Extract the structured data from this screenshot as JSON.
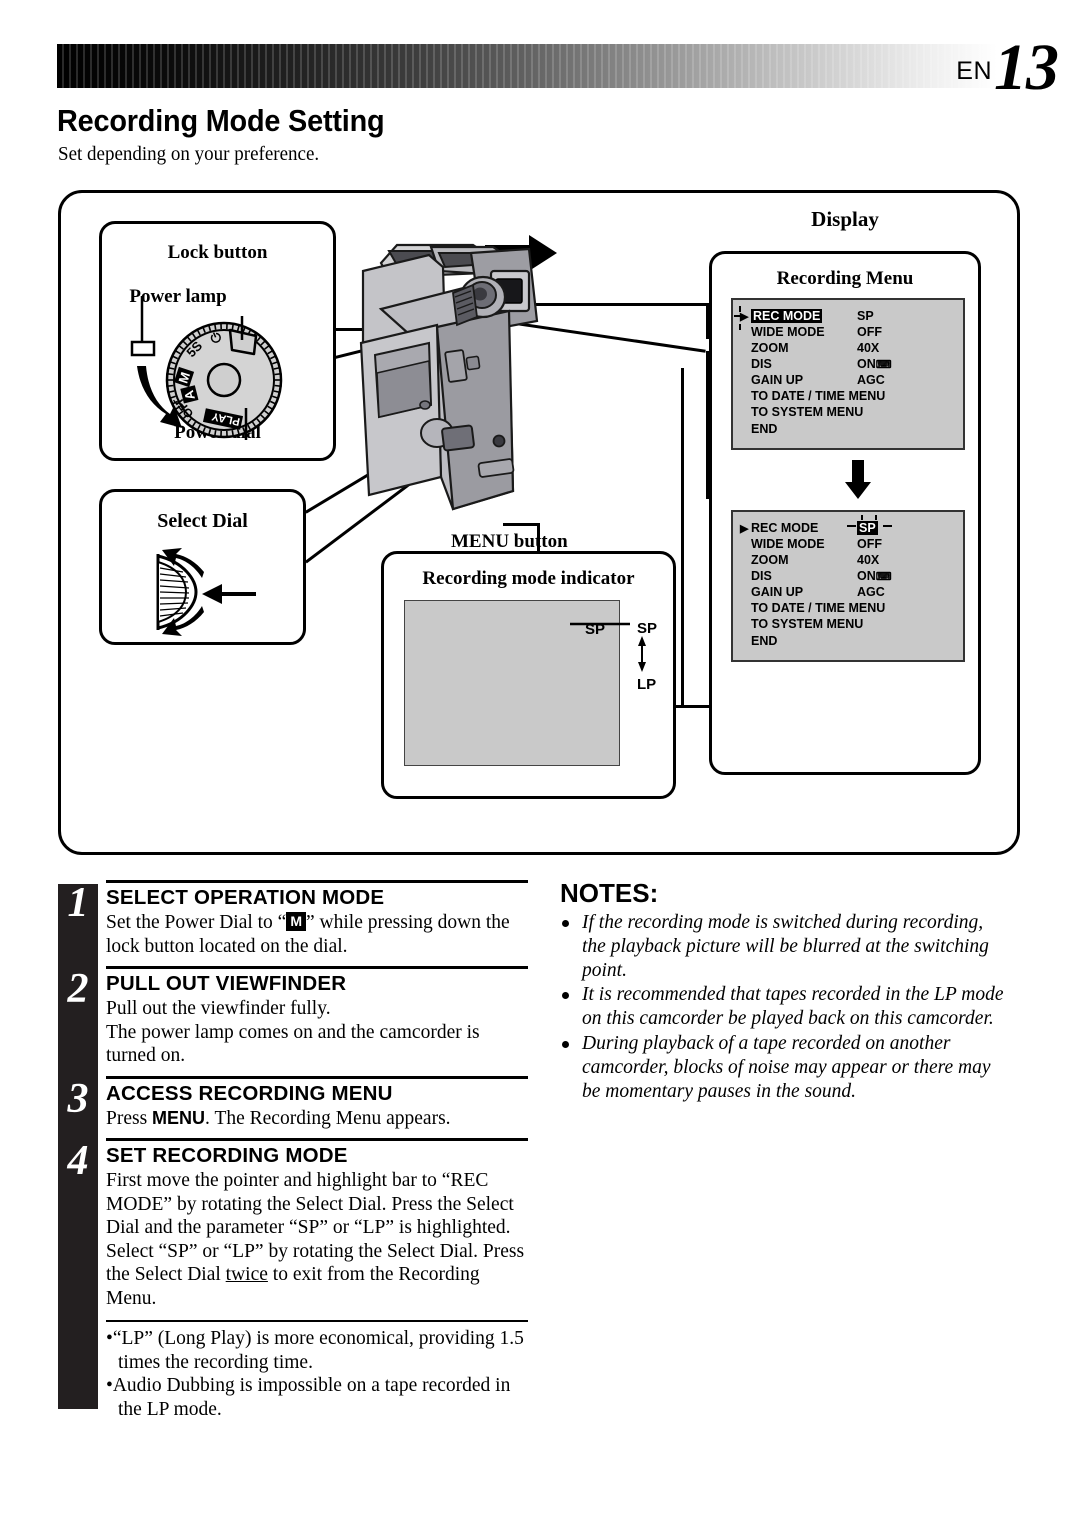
{
  "header": {
    "lang_code": "EN",
    "page_number": "13"
  },
  "page_title": "Recording Mode Setting",
  "subtitle": "Set depending on your preference.",
  "diagram": {
    "power_panel": {
      "lock_button_label": "Lock button",
      "power_lamp_label": "Power lamp",
      "power_dial_label": "Power dial",
      "dial_positions": [
        "⏻",
        "5S",
        "M",
        "A",
        "OFF",
        "PLAY"
      ]
    },
    "select_dial_panel": {
      "label": "Select Dial"
    },
    "camcorder": {
      "menu_button_label": "MENU button"
    },
    "rec_indicator_panel": {
      "label": "Recording mode indicator",
      "screen_value": "SP",
      "callout_top": "SP",
      "callout_bottom": "LP"
    },
    "display_panel": {
      "display_label": "Display",
      "recording_menu_label": "Recording Menu",
      "menu_screen_1": {
        "pointer_row": 0,
        "highlight": "label",
        "rows": [
          {
            "label": "REC MODE",
            "value": "SP"
          },
          {
            "label": "WIDE MODE",
            "value": "OFF"
          },
          {
            "label": "ZOOM",
            "value": "40X"
          },
          {
            "label": "DIS",
            "value": "ON"
          },
          {
            "label": "GAIN UP",
            "value": "AGC"
          },
          {
            "label": "TO DATE / TIME MENU",
            "value": ""
          },
          {
            "label": "TO SYSTEM MENU",
            "value": ""
          }
        ],
        "end_label": "END"
      },
      "menu_screen_2": {
        "pointer_row": 0,
        "highlight": "value",
        "rows": [
          {
            "label": "REC MODE",
            "value": "SP"
          },
          {
            "label": "WIDE MODE",
            "value": "OFF"
          },
          {
            "label": "ZOOM",
            "value": "40X"
          },
          {
            "label": "DIS",
            "value": "ON"
          },
          {
            "label": "GAIN UP",
            "value": "AGC"
          },
          {
            "label": "TO DATE / TIME MENU",
            "value": ""
          },
          {
            "label": "TO SYSTEM MENU",
            "value": ""
          }
        ],
        "end_label": "END"
      }
    }
  },
  "steps": [
    {
      "number": "1",
      "title": "SELECT OPERATION MODE",
      "body_before": "Set the Power Dial to “",
      "body_badge": "M",
      "body_after": "” while pressing down the lock button located on the dial."
    },
    {
      "number": "2",
      "title": "PULL OUT VIEWFINDER",
      "body": "Pull out the viewfinder fully.\nThe power lamp comes on and the camcorder is turned on."
    },
    {
      "number": "3",
      "title": "ACCESS RECORDING MENU",
      "body_before": "Press ",
      "body_bold": "MENU",
      "body_after": ". The Recording Menu appears."
    },
    {
      "number": "4",
      "title": "SET RECORDING MODE",
      "body_before": "First move the pointer and highlight bar to “REC MODE” by rotating the Select Dial. Press the Select Dial and the parameter “SP” or “LP” is highlighted. Select “SP” or “LP” by rotating the Select Dial. Press the Select Dial ",
      "body_underline": "twice",
      "body_after": " to exit from the Recording Menu."
    }
  ],
  "step_bullets": [
    "•“LP” (Long Play) is more economical, providing 1.5 times the recording time.",
    "•Audio Dubbing is impossible on a tape recorded in the LP mode."
  ],
  "notes": {
    "title": "NOTES:",
    "items": [
      "If the recording mode is switched during recording, the playback picture will be blurred at the switching point.",
      "It is recommended that tapes recorded in the LP mode on this camcorder be played back on this camcorder.",
      "During playback of a tape recorded on another camcorder, blocks of noise may appear or there may be momentary pauses in the sound."
    ]
  },
  "colors": {
    "black_bar": "#231f20",
    "osd_background": "#c9c9c9",
    "screen_gray": "#c9c9c9"
  }
}
